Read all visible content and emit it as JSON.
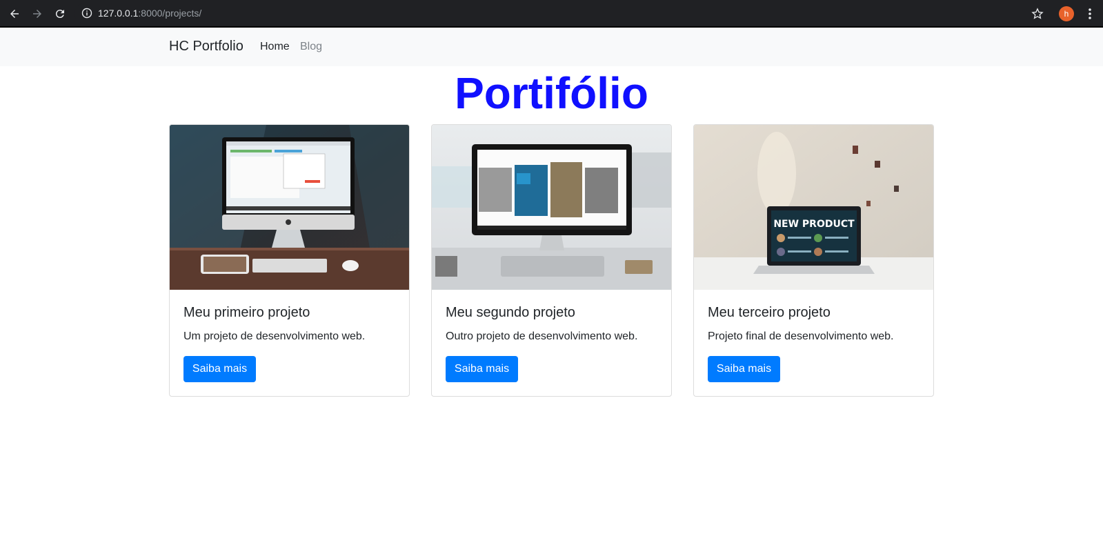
{
  "browser": {
    "url_host": "127.0.0.1",
    "url_rest": ":8000/projects/",
    "avatar_letter": "h",
    "icons": [
      "back-icon",
      "forward-icon",
      "reload-icon",
      "info-icon",
      "star-icon",
      "kebab-menu-icon"
    ]
  },
  "navbar": {
    "brand": "HC Portfolio",
    "links": [
      {
        "label": "Home",
        "active": true
      },
      {
        "label": "Blog",
        "active": false
      }
    ]
  },
  "page": {
    "title": "Portifólio",
    "title_color": "#1010ff"
  },
  "projects": [
    {
      "title": "Meu primeiro projeto",
      "description": "Um projeto de desenvolvimento web.",
      "button": "Saiba mais"
    },
    {
      "title": "Meu segundo projeto",
      "description": "Outro projeto de desenvolvimento web.",
      "button": "Saiba mais"
    },
    {
      "title": "Meu terceiro projeto",
      "description": "Projeto final de desenvolvimento web.",
      "button": "Saiba mais",
      "image_text": "NEW PRODUCT"
    }
  ],
  "colors": {
    "primary_button": "#007bff",
    "navbar_bg": "#f8f9fa",
    "browser_bg": "#202124"
  }
}
